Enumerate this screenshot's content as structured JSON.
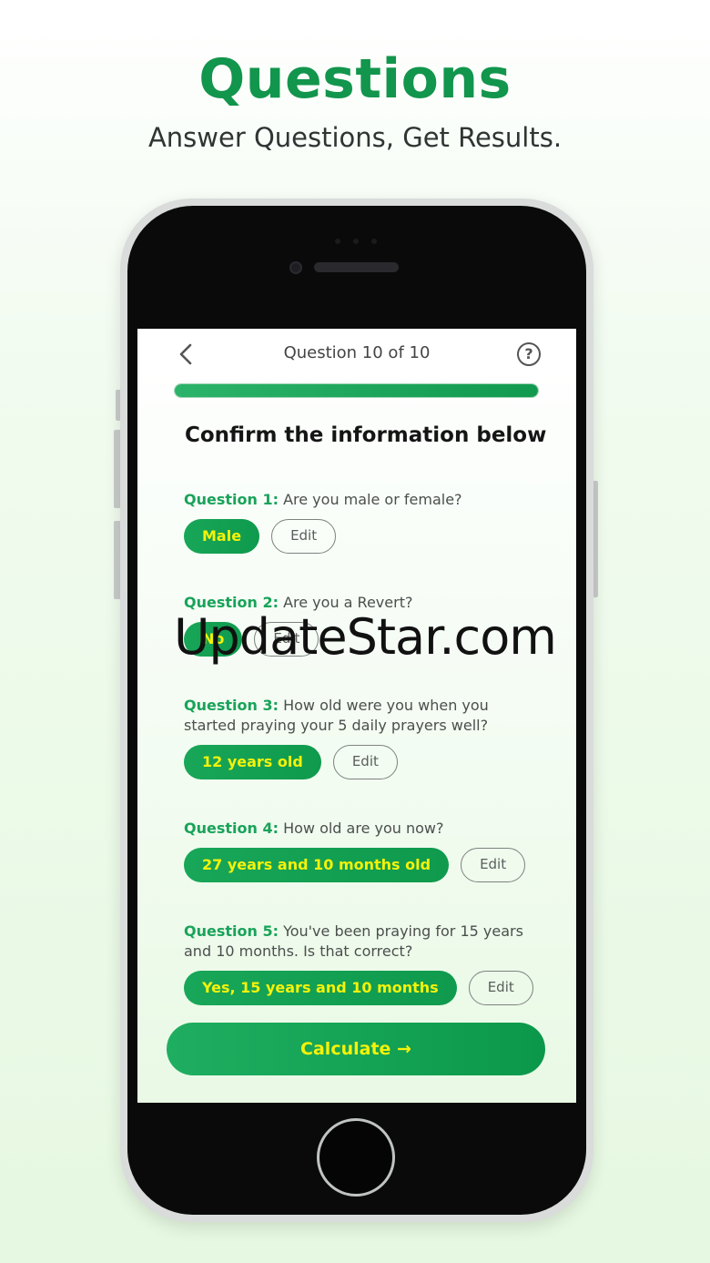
{
  "promo": {
    "headline": "Questions",
    "subtitle": "Answer Questions, Get Results."
  },
  "header": {
    "back_icon": "chevron-left-icon",
    "counter": "Question 10 of 10",
    "help_icon": "question-circle-icon",
    "help_glyph": "?",
    "progress": 1.0
  },
  "section_title": "Confirm the information below",
  "questions": [
    {
      "label": "Question 1:",
      "text": "Are you male or female?",
      "answer": "Male",
      "edit": "Edit"
    },
    {
      "label": "Question 2:",
      "text": "Are you a Revert?",
      "answer": "No",
      "edit": "Edit"
    },
    {
      "label": "Question 3:",
      "text": "How old were you when you started praying your 5 daily prayers well?",
      "answer": "12 years old",
      "edit": "Edit"
    },
    {
      "label": "Question 4:",
      "text": "How old are you now?",
      "answer": "27 years and 10 months old",
      "edit": "Edit"
    },
    {
      "label": "Question 5:",
      "text": "You've been praying for 15 years and 10 months. Is that correct?",
      "answer": "Yes, 15 years and 10 months",
      "edit": "Edit"
    }
  ],
  "calculate": {
    "label": "Calculate →"
  },
  "watermark": "UpdateStar.com",
  "colors": {
    "accent": "#12954c",
    "answer_text": "#f4f20a"
  }
}
